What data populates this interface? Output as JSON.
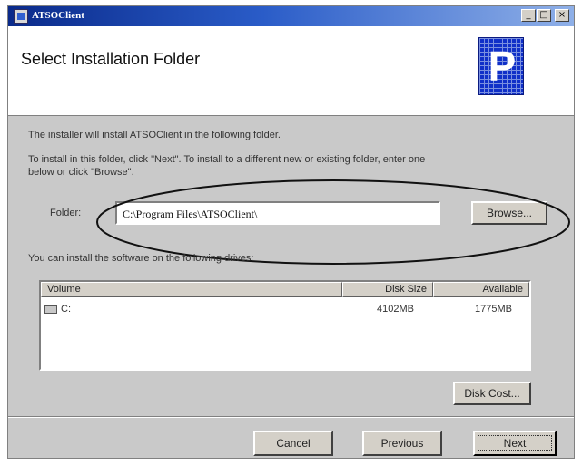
{
  "window": {
    "title": "ATSOClient",
    "min_glyph": "_",
    "max_glyph": "□",
    "close_glyph": "×"
  },
  "header": {
    "title": "Select Installation Folder",
    "logo_letter": "P"
  },
  "body": {
    "intro_text": "The installer will install ATSOClient in the following folder.",
    "instruction_line1": "To install in this folder, click \"Next\". To install to a different new or existing folder, enter one",
    "instruction_line2": "below or click \"Browse\".",
    "folder_label": "Folder:",
    "folder_value": "C:\\Program Files\\ATSOClient\\",
    "browse_label": "Browse...",
    "drives_text": "You can install the software on the following drives:"
  },
  "drives": {
    "columns": [
      "Volume",
      "Disk Size",
      "Available"
    ],
    "rows": [
      {
        "volume": "C:",
        "disk_size": "4102MB",
        "available": "1775MB"
      }
    ]
  },
  "buttons": {
    "disk_cost": "Disk Cost...",
    "cancel": "Cancel",
    "previous": "Previous",
    "next": "Next"
  },
  "colors": {
    "title_bar": "#0a2a8a",
    "dialog_bg": "#c9c9c9",
    "logo_blue": "#1030c8"
  }
}
